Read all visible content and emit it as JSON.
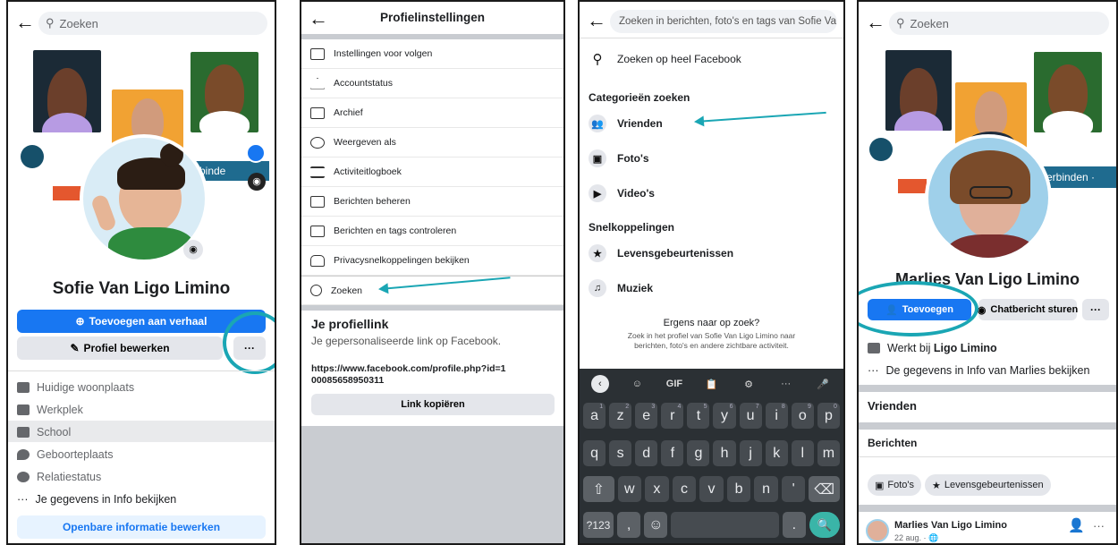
{
  "panel1": {
    "search_placeholder": "Zoeken",
    "cover_text": "rbinde",
    "name": "Sofie Van Ligo Limino",
    "add_story": "Toevoegen aan verhaal",
    "edit_profile": "Profiel bewerken",
    "more": "···",
    "details": [
      {
        "label": "Huidige woonplaats",
        "icon": "home-icon"
      },
      {
        "label": "Werkplek",
        "icon": "briefcase-icon"
      },
      {
        "label": "School",
        "icon": "graduation-cap-icon"
      },
      {
        "label": "Geboorteplaats",
        "icon": "location-pin-icon"
      },
      {
        "label": "Relatiestatus",
        "icon": "heart-icon"
      }
    ],
    "see_info": "Je gegevens in Info bekijken",
    "edit_public": "Openbare informatie bewerken"
  },
  "panel2": {
    "title": "Profielinstellingen",
    "items": [
      "Instellingen voor volgen",
      "Accountstatus",
      "Archief",
      "Weergeven als",
      "Activiteitlogboek",
      "Berichten beheren",
      "Berichten en tags controleren",
      "Privacysnelkoppelingen bekijken",
      "Zoeken"
    ],
    "link_title": "Je profiellink",
    "link_sub": "Je gepersonaliseerde link op Facebook.",
    "link_url": "https://www.facebook.com/profile.php?id=100085658950311",
    "copy_link": "Link kopiëren"
  },
  "panel3": {
    "search_placeholder": "Zoeken in berichten, foto's en tags van Sofie Va...",
    "search_all": "Zoeken op heel Facebook",
    "cat_heading": "Categorieën zoeken",
    "categories": [
      "Vrienden",
      "Foto's",
      "Video's"
    ],
    "shortcut_heading": "Snelkoppelingen",
    "shortcuts": [
      "Levensgebeurtenissen",
      "Muziek"
    ],
    "hint_title": "Ergens naar op zoek?",
    "hint_text": "Zoek in het profiel van Sofie Van Ligo Limino naar berichten, foto's en andere zichtbare activiteit.",
    "keyboard": {
      "top": [
        "‹",
        "☺",
        "GIF",
        "📋",
        "⚙",
        "···",
        "🎤"
      ],
      "row1": [
        "a",
        "z",
        "e",
        "r",
        "t",
        "y",
        "u",
        "i",
        "o",
        "p"
      ],
      "row1_hints": [
        "1",
        "2",
        "3",
        "4",
        "5",
        "6",
        "7",
        "8",
        "9",
        "0"
      ],
      "row2": [
        "q",
        "s",
        "d",
        "f",
        "g",
        "h",
        "j",
        "k",
        "l",
        "m"
      ],
      "row3": [
        "⇧",
        "w",
        "x",
        "c",
        "v",
        "b",
        "n",
        "'",
        "⌫"
      ],
      "row4": [
        "?123",
        ",",
        "☺",
        " ",
        ".",
        "🔍"
      ]
    }
  },
  "panel4": {
    "search_placeholder": "Zoeken",
    "cover_text": "erbinden ·",
    "name": "Marlies Van Ligo Limino",
    "add_friend": "Toevoegen",
    "message": "Chatbericht sturen",
    "more": "···",
    "works_at_prefix": "Werkt bij ",
    "works_at_place": "Ligo Limino",
    "see_info": "De gegevens in Info van Marlies bekijken",
    "friends": "Vrienden",
    "posts": "Berichten",
    "chips": [
      "Foto's",
      "Levensgebeurtenissen"
    ],
    "post_author": "Marlies Van Ligo Limino",
    "post_date": "22 aug. · 🌐"
  },
  "colors": {
    "facebook_blue": "#1877f2",
    "annotation_teal": "#1aa6b4"
  }
}
